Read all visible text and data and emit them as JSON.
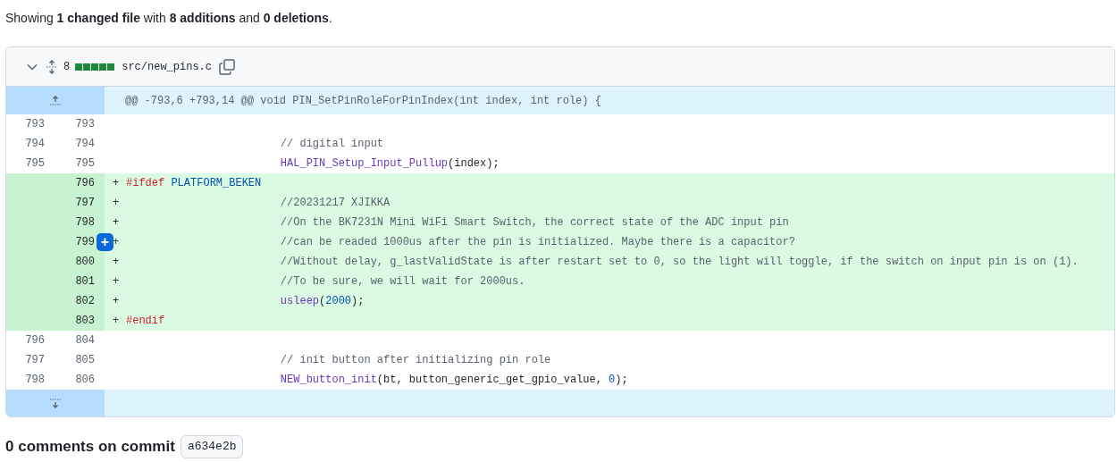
{
  "summary": "Showing **1 changed file** with **8 additions** and **0 deletions**.",
  "file": {
    "expanded": true,
    "changes": "8",
    "diffstat": [
      {
        "kind": "added"
      },
      {
        "kind": "added"
      },
      {
        "kind": "added"
      },
      {
        "kind": "added"
      },
      {
        "kind": "added"
      }
    ],
    "path": "src/new_pins.c",
    "rows": [
      {
        "kind": "hunk",
        "text": "@@ -793,6 +793,14 @@ void PIN_SetPinRoleForPinIndex(int index, int role) {"
      },
      {
        "kind": "context",
        "old": "793",
        "new": "793",
        "tokens": []
      },
      {
        "kind": "context",
        "old": "794",
        "new": "794",
        "tokens": [
          {
            "kind": "comment",
            "text": "                        // digital input"
          }
        ]
      },
      {
        "kind": "context",
        "old": "795",
        "new": "795",
        "tokens": [
          {
            "kind": "function",
            "text": "                        HAL_PIN_Setup_Input_Pullup"
          },
          {
            "kind": "plain",
            "text": "(index);"
          }
        ]
      },
      {
        "kind": "addition",
        "new": "796",
        "marker": "+",
        "tokens": [
          {
            "kind": "keyword",
            "text": "#ifdef"
          },
          {
            "kind": "constant",
            "text": " PLATFORM_BEKEN"
          }
        ]
      },
      {
        "kind": "addition",
        "new": "797",
        "marker": "+",
        "tokens": [
          {
            "kind": "comment",
            "text": "                        //20231217 XJIKKA"
          }
        ]
      },
      {
        "kind": "addition",
        "new": "798",
        "marker": "+",
        "tokens": [
          {
            "kind": "comment",
            "text": "                        //On the BK7231N Mini WiFi Smart Switch, the correct state of the ADC input pin"
          }
        ]
      },
      {
        "kind": "addition",
        "new": "799",
        "marker": "+",
        "comment_button": "+",
        "tokens": [
          {
            "kind": "comment",
            "text": "                        //can be readed 1000us after the pin is initialized. Maybe there is a capacitor?"
          }
        ]
      },
      {
        "kind": "addition",
        "new": "800",
        "marker": "+",
        "tokens": [
          {
            "kind": "comment",
            "text": "                        //Without delay, g_lastValidState is after restart set to 0, so the light will toggle, if the switch on input pin is on (1)."
          }
        ]
      },
      {
        "kind": "addition",
        "new": "801",
        "marker": "+",
        "tokens": [
          {
            "kind": "comment",
            "text": "                        //To be sure, we will wait for 2000us."
          }
        ]
      },
      {
        "kind": "addition",
        "new": "802",
        "marker": "+",
        "tokens": [
          {
            "kind": "function",
            "text": "                        usleep"
          },
          {
            "kind": "plain",
            "text": "("
          },
          {
            "kind": "constant",
            "text": "2000"
          },
          {
            "kind": "plain",
            "text": ");"
          }
        ]
      },
      {
        "kind": "addition",
        "new": "803",
        "marker": "+",
        "tokens": [
          {
            "kind": "keyword",
            "text": "#endif"
          }
        ]
      },
      {
        "kind": "context",
        "old": "796",
        "new": "804",
        "tokens": []
      },
      {
        "kind": "context",
        "old": "797",
        "new": "805",
        "tokens": [
          {
            "kind": "comment",
            "text": "                        // init button after initializing pin role"
          }
        ]
      },
      {
        "kind": "context",
        "old": "798",
        "new": "806",
        "tokens": [
          {
            "kind": "function",
            "text": "                        NEW_button_init"
          },
          {
            "kind": "plain",
            "text": "(bt, button_generic_get_gpio_value, "
          },
          {
            "kind": "constant",
            "text": "0"
          },
          {
            "kind": "plain",
            "text": ");"
          }
        ]
      },
      {
        "kind": "expand"
      }
    ]
  },
  "comments_heading": "0 comments on commit",
  "commit": "a634e2b"
}
